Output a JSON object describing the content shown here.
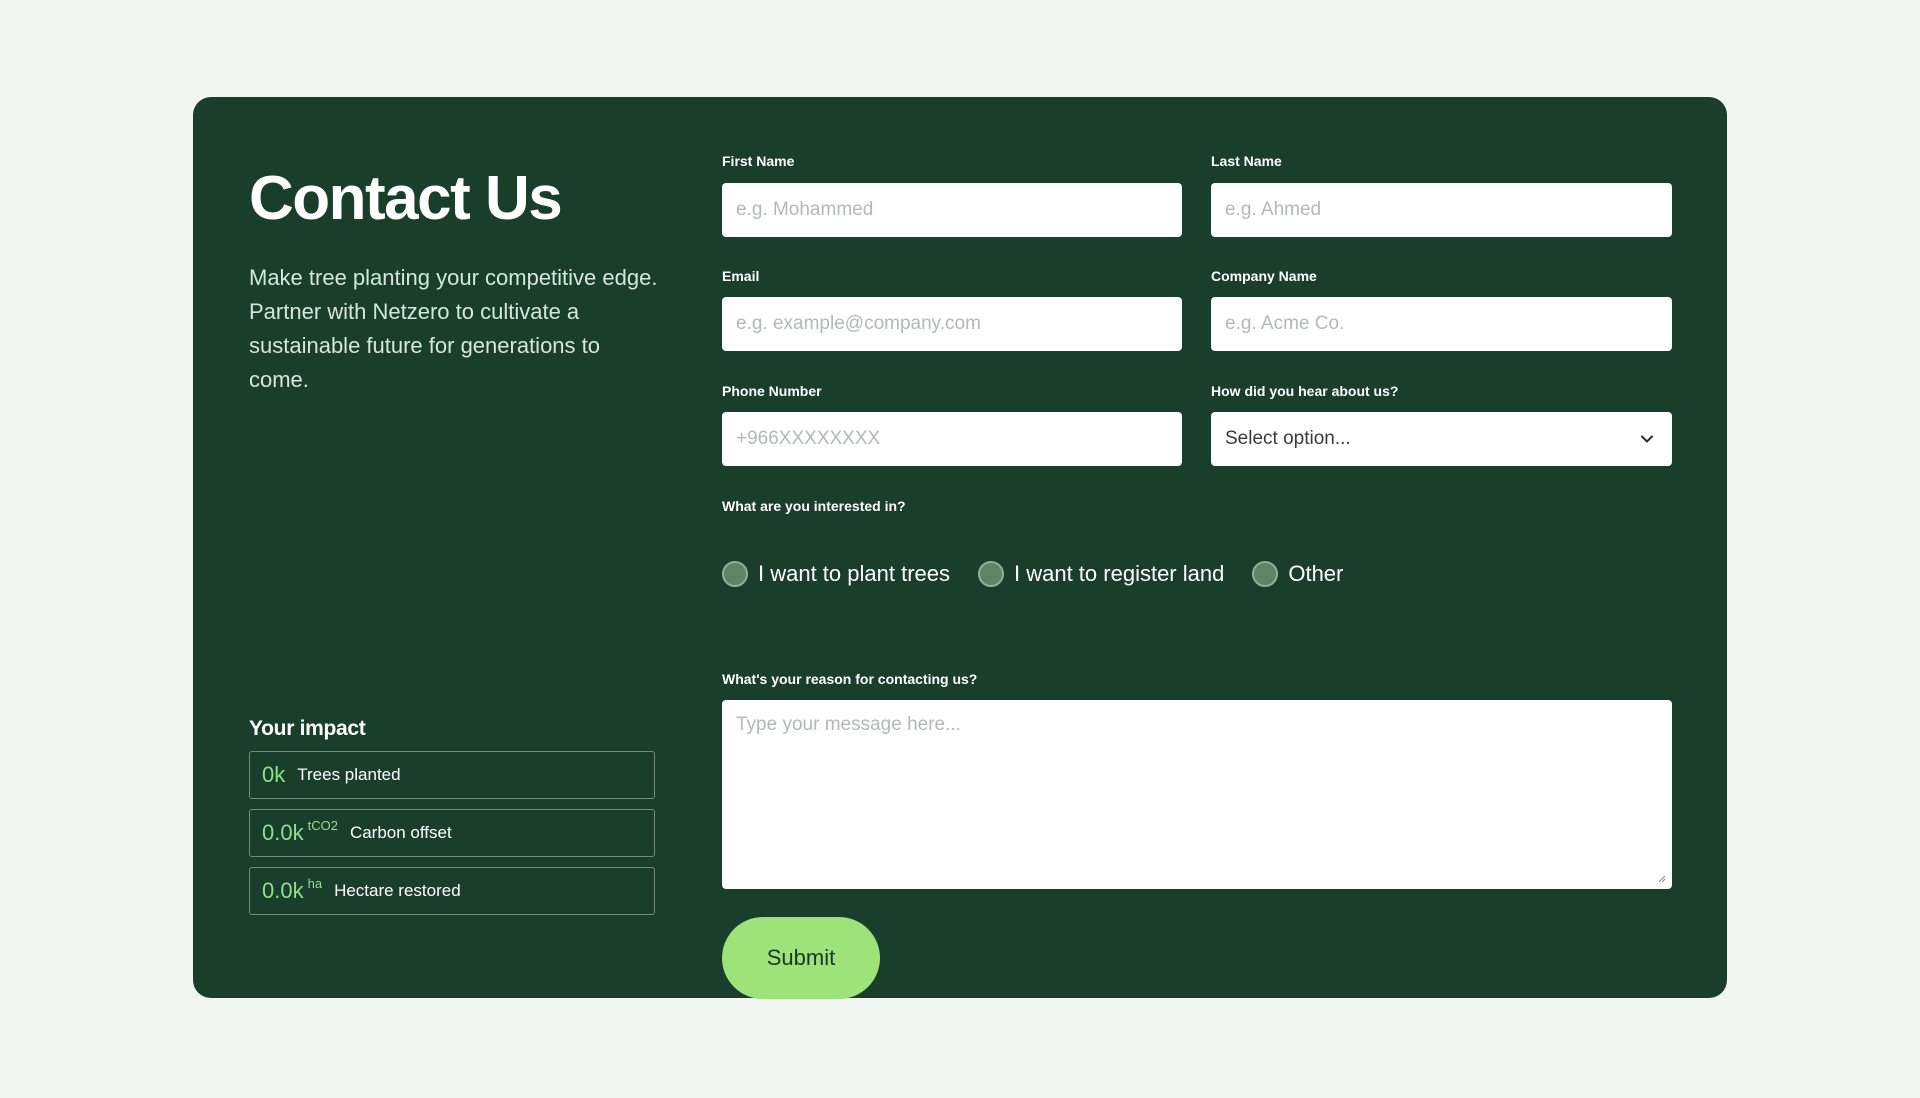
{
  "hero": {
    "title": "Contact Us",
    "description": "Make tree planting your competitive edge. Partner with Netzero to cultivate a sustainable future for generations to come."
  },
  "impact": {
    "title": "Your impact",
    "stats": [
      {
        "value": "0k",
        "unit": "",
        "label": "Trees planted"
      },
      {
        "value": "0.0k",
        "unit": "tCO2",
        "label": "Carbon offset"
      },
      {
        "value": "0.0k",
        "unit": "ha",
        "label": "Hectare restored"
      }
    ]
  },
  "form": {
    "first_name": {
      "label": "First Name",
      "placeholder": "e.g. Mohammed"
    },
    "last_name": {
      "label": "Last Name",
      "placeholder": "e.g. Ahmed"
    },
    "email": {
      "label": "Email",
      "placeholder": "e.g. example@company.com"
    },
    "company": {
      "label": "Company Name",
      "placeholder": "e.g. Acme Co."
    },
    "phone": {
      "label": "Phone Number",
      "placeholder": "+966XXXXXXXX"
    },
    "source": {
      "label": "How did you hear about us?",
      "value": "Select option..."
    },
    "interest": {
      "label": "What are you interested in?",
      "options": [
        "I want to plant trees",
        "I want to register land",
        "Other"
      ]
    },
    "reason": {
      "label": "What's your reason for contacting us?",
      "placeholder": "Type your message here..."
    },
    "submit_label": "Submit"
  },
  "colors": {
    "card_bg": "#1a3e2c",
    "page_bg": "#f0f5f1",
    "accent_green": "#9ee37a",
    "stat_green": "#8fe08a"
  }
}
